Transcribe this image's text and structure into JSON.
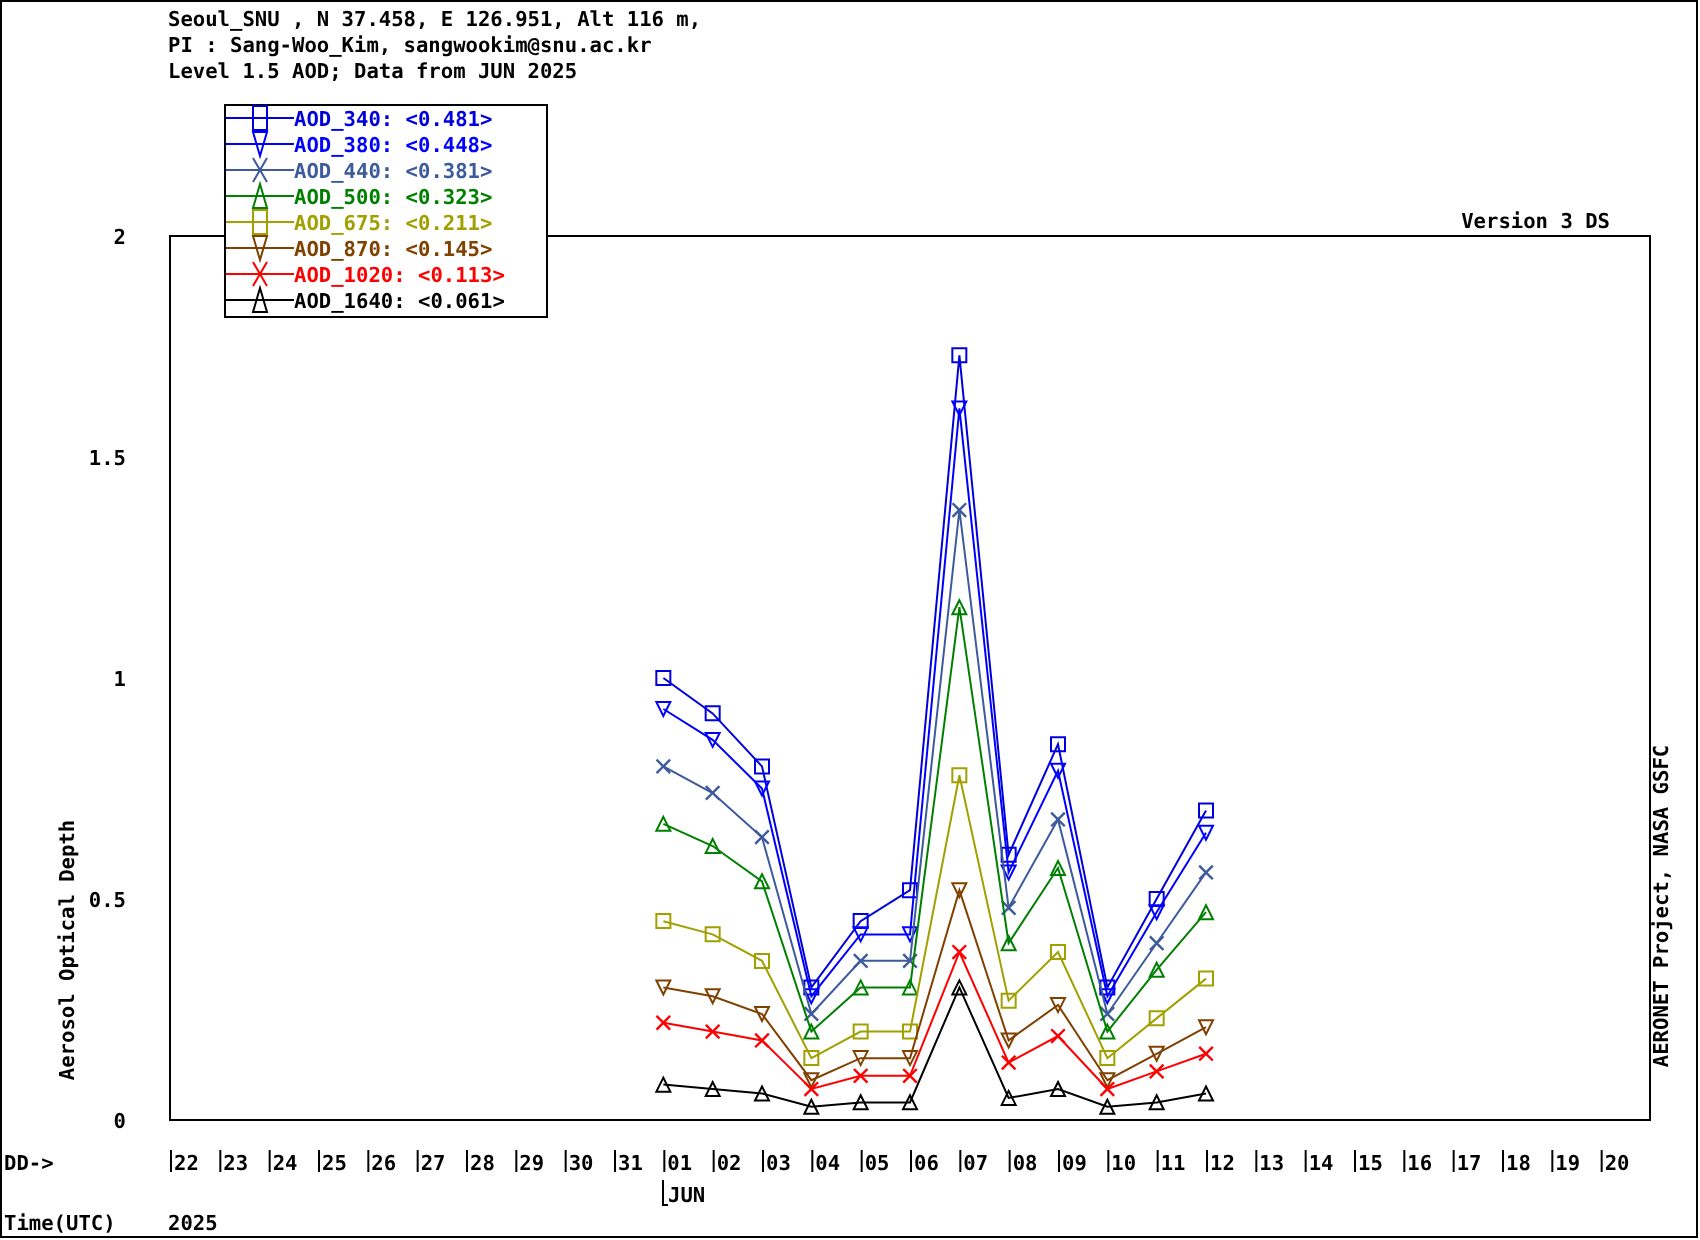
{
  "header": {
    "lines": [
      "Seoul_SNU , N 37.458, E 126.951, Alt 116 m,",
      "PI : Sang-Woo_Kim, sangwookim@snu.ac.kr",
      "Level 1.5 AOD; Data from JUN 2025"
    ]
  },
  "version": "Version 3 DS",
  "credit": "AERONET Project, NASA GSFC",
  "day_axis_label": "DD->",
  "month_label": "JUN",
  "time_label": "Time(UTC)",
  "year_label": "2025",
  "chart_data": {
    "type": "line",
    "legend": "upper left",
    "ylabel": "Aerosol Optical Depth",
    "ylim": [
      0,
      2
    ],
    "yticks": [
      {
        "value": 0,
        "label": "0"
      },
      {
        "value": 0.5,
        "label": "0.5"
      },
      {
        "value": 1,
        "label": "1"
      },
      {
        "value": 1.5,
        "label": "1.5"
      },
      {
        "value": 2,
        "label": "2"
      }
    ],
    "categories": [
      "22",
      "23",
      "24",
      "25",
      "26",
      "27",
      "28",
      "29",
      "30",
      "31",
      "01",
      "02",
      "03",
      "04",
      "05",
      "06",
      "07",
      "08",
      "09",
      "10",
      "11",
      "12",
      "13",
      "14",
      "15",
      "16",
      "17",
      "18",
      "19",
      "20"
    ],
    "series": [
      {
        "name": "AOD_340: <0.481>",
        "color": "#0000dd",
        "marker": "square",
        "values": [
          null,
          null,
          null,
          null,
          null,
          null,
          null,
          null,
          null,
          null,
          1.0,
          0.92,
          0.8,
          0.3,
          0.45,
          0.52,
          1.73,
          0.6,
          0.85,
          0.3,
          0.5,
          0.7,
          null,
          null,
          null,
          null,
          null,
          null,
          null,
          null
        ]
      },
      {
        "name": "AOD_380: <0.448>",
        "color": "#0000ff",
        "marker": "triangle-down",
        "values": [
          null,
          null,
          null,
          null,
          null,
          null,
          null,
          null,
          null,
          null,
          0.93,
          0.86,
          0.75,
          0.28,
          0.42,
          0.42,
          1.61,
          0.56,
          0.79,
          0.28,
          0.47,
          0.65,
          null,
          null,
          null,
          null,
          null,
          null,
          null,
          null
        ]
      },
      {
        "name": "AOD_440: <0.381>",
        "color": "#3c5a9c",
        "marker": "cross",
        "values": [
          null,
          null,
          null,
          null,
          null,
          null,
          null,
          null,
          null,
          null,
          0.8,
          0.74,
          0.64,
          0.24,
          0.36,
          0.36,
          1.38,
          0.48,
          0.68,
          0.24,
          0.4,
          0.56,
          null,
          null,
          null,
          null,
          null,
          null,
          null,
          null
        ]
      },
      {
        "name": "AOD_500: <0.323>",
        "color": "#008000",
        "marker": "triangle-up",
        "values": [
          null,
          null,
          null,
          null,
          null,
          null,
          null,
          null,
          null,
          null,
          0.67,
          0.62,
          0.54,
          0.2,
          0.3,
          0.3,
          1.16,
          0.4,
          0.57,
          0.2,
          0.34,
          0.47,
          null,
          null,
          null,
          null,
          null,
          null,
          null,
          null
        ]
      },
      {
        "name": "AOD_675: <0.211>",
        "color": "#a0a000",
        "marker": "square",
        "values": [
          null,
          null,
          null,
          null,
          null,
          null,
          null,
          null,
          null,
          null,
          0.45,
          0.42,
          0.36,
          0.14,
          0.2,
          0.2,
          0.78,
          0.27,
          0.38,
          0.14,
          0.23,
          0.32,
          null,
          null,
          null,
          null,
          null,
          null,
          null,
          null
        ]
      },
      {
        "name": "AOD_870: <0.145>",
        "color": "#804000",
        "marker": "triangle-down",
        "values": [
          null,
          null,
          null,
          null,
          null,
          null,
          null,
          null,
          null,
          null,
          0.3,
          0.28,
          0.24,
          0.09,
          0.14,
          0.14,
          0.52,
          0.18,
          0.26,
          0.09,
          0.15,
          0.21,
          null,
          null,
          null,
          null,
          null,
          null,
          null,
          null
        ]
      },
      {
        "name": "AOD_1020: <0.113>",
        "color": "#ff0000",
        "marker": "cross",
        "values": [
          null,
          null,
          null,
          null,
          null,
          null,
          null,
          null,
          null,
          null,
          0.22,
          0.2,
          0.18,
          0.07,
          0.1,
          0.1,
          0.38,
          0.13,
          0.19,
          0.07,
          0.11,
          0.15,
          null,
          null,
          null,
          null,
          null,
          null,
          null,
          null
        ]
      },
      {
        "name": "AOD_1640: <0.061>",
        "color": "#000000",
        "marker": "triangle-up",
        "values": [
          null,
          null,
          null,
          null,
          null,
          null,
          null,
          null,
          null,
          null,
          0.08,
          0.07,
          0.06,
          0.03,
          0.04,
          0.04,
          0.3,
          0.05,
          0.07,
          0.03,
          0.04,
          0.06,
          null,
          null,
          null,
          null,
          null,
          null,
          null,
          null
        ]
      }
    ]
  }
}
